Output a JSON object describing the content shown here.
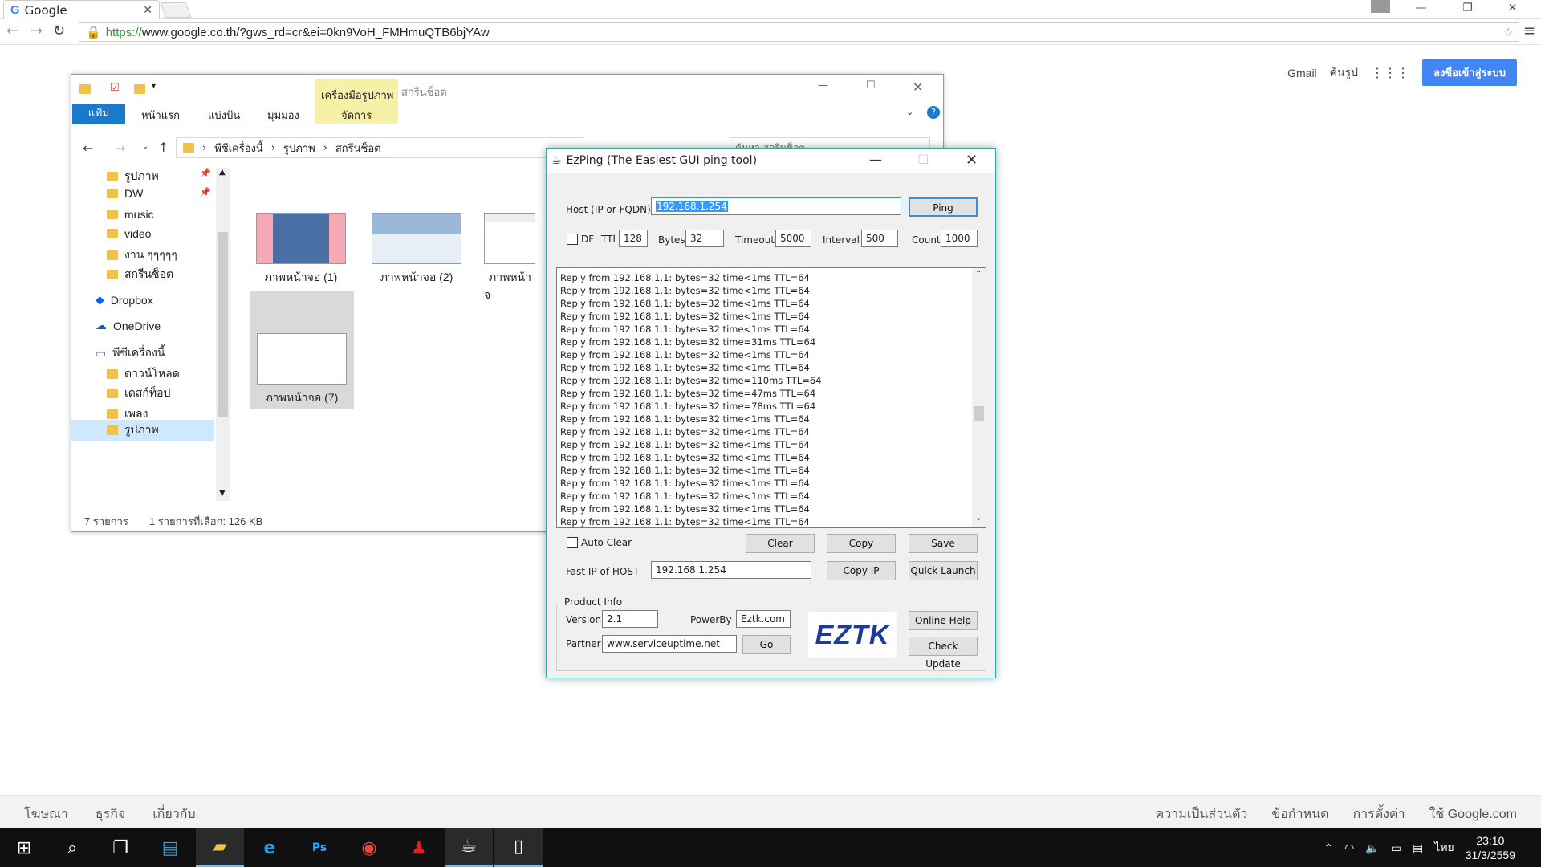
{
  "browser": {
    "tab_title": "Google",
    "tab_icon": "G",
    "url_https": "https://",
    "url_rest": "www.google.co.th/?gws_rd=cr&ei=0kn9VoH_FMHmuQTB6bjYAw"
  },
  "google": {
    "header_links": [
      "Gmail",
      "ค้นรูป"
    ],
    "sign_in": "ลงชื่อเข้าสู่ระบบ",
    "footer_left": [
      "โฆษณา",
      "ธุรกิจ",
      "เกี่ยวกับ"
    ],
    "footer_right": [
      "ความเป็นส่วนตัว",
      "ข้อกำหนด",
      "การตั้งค่า",
      "ใช้ Google.com"
    ]
  },
  "explorer": {
    "title": "สกรีนช็อต",
    "tools_tab": "เครื่องมือรูปภาพ",
    "manage_tab": "จัดการ",
    "ribbon_tabs": [
      "แฟ้ม",
      "หน้าแรก",
      "แบ่งปัน",
      "มุมมอง"
    ],
    "breadcrumb": [
      "พีซีเครื่องนี้",
      "รูปภาพ",
      "สกรีนช็อต"
    ],
    "search_placeholder": "ค้นหา สกรีนช็อต",
    "nav": [
      "รูปภาพ",
      "DW",
      "music",
      "video",
      "งาน ๆๆๆๆๆ",
      "สกรีนช็อต",
      "Dropbox",
      "OneDrive",
      "พีซีเครื่องนี้",
      "ดาวน์โหลด",
      "เดสก์ท็อป",
      "เพลง",
      "รูปภาพ"
    ],
    "files": [
      "ภาพหน้าจอ (1)",
      "ภาพหน้าจอ (2)",
      "ภาพหน้าจ",
      "ภาพหน้าจอ (7)"
    ],
    "status_count": "7 รายการ",
    "status_selected": "1 รายการที่เลือก: 126 KB"
  },
  "ezping": {
    "title": "EzPing (The Easiest GUI ping tool)",
    "host_label": "Host (IP or FQDN)",
    "host_value": "192.168.1.254",
    "ping_button": "Ping",
    "df_label": "DF",
    "ttl_label": "TTl",
    "ttl_value": "128",
    "bytes_label": "Bytes",
    "bytes_value": "32",
    "timeout_label": "Timeout",
    "timeout_value": "5000",
    "interval_label": "Interval",
    "interval_value": "500",
    "count_label": "Count",
    "count_value": "1000",
    "log": [
      "Reply from 192.168.1.1: bytes=32 time<1ms TTL=64",
      "Reply from 192.168.1.1: bytes=32 time<1ms TTL=64",
      "Reply from 192.168.1.1: bytes=32 time<1ms TTL=64",
      "Reply from 192.168.1.1: bytes=32 time<1ms TTL=64",
      "Reply from 192.168.1.1: bytes=32 time<1ms TTL=64",
      "Reply from 192.168.1.1: bytes=32 time=31ms TTL=64",
      "Reply from 192.168.1.1: bytes=32 time<1ms TTL=64",
      "Reply from 192.168.1.1: bytes=32 time<1ms TTL=64",
      "Reply from 192.168.1.1: bytes=32 time=110ms TTL=64",
      "Reply from 192.168.1.1: bytes=32 time=47ms TTL=64",
      "Reply from 192.168.1.1: bytes=32 time=78ms TTL=64",
      "Reply from 192.168.1.1: bytes=32 time<1ms TTL=64",
      "Reply from 192.168.1.1: bytes=32 time<1ms TTL=64",
      "Reply from 192.168.1.1: bytes=32 time<1ms TTL=64",
      "Reply from 192.168.1.1: bytes=32 time<1ms TTL=64",
      "Reply from 192.168.1.1: bytes=32 time<1ms TTL=64",
      "Reply from 192.168.1.1: bytes=32 time<1ms TTL=64",
      "Reply from 192.168.1.1: bytes=32 time<1ms TTL=64",
      "Reply from 192.168.1.1: bytes=32 time<1ms TTL=64",
      "Reply from 192.168.1.1: bytes=32 time<1ms TTL=64"
    ],
    "auto_clear_label": "Auto Clear",
    "clear_button": "Clear",
    "copy_button": "Copy",
    "save_button": "Save",
    "fast_ip_label": "Fast IP of HOST",
    "fast_ip_value": "192.168.1.254",
    "copy_ip_button": "Copy IP",
    "quick_launch_button": "Quick Launch",
    "product_info_label": "Product Info",
    "version_label": "Version",
    "version_value": "2.1",
    "powerby_label": "PowerBy",
    "powerby_value": "Eztk.com",
    "partner_label": "Partner",
    "partner_value": "www.serviceuptime.net",
    "go_button": "Go",
    "logo_text": "EZTK",
    "online_help_button": "Online Help",
    "check_update_button": "Check Update"
  },
  "taskbar": {
    "lang": "ไทย",
    "time": "23:10",
    "date": "31/3/2559"
  }
}
